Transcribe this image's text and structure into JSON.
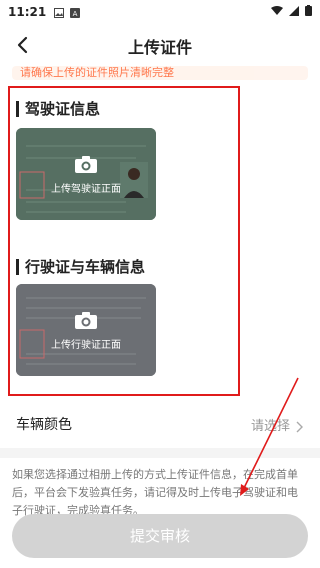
{
  "status": {
    "time": "11:21"
  },
  "nav": {
    "title": "上传证件"
  },
  "notice": {
    "text": "请确保上传的证件照片清晰完整"
  },
  "sections": [
    {
      "title": "驾驶证信息",
      "card_label": "上传驾驶证正面"
    },
    {
      "title": "行驶证与车辆信息",
      "card_label": "上传行驶证正面"
    }
  ],
  "vehicle_color": {
    "label": "车辆颜色",
    "value": "请选择"
  },
  "help_text": "如果您选择通过相册上传的方式上传证件信息，在完成首单后，平台会下发验真任务，请记得及时上传电子驾驶证和电子行驶证，完成验真任务。",
  "submit": {
    "label": "提交审核"
  },
  "colors": {
    "highlight": "#e01b1b",
    "accent": "#ff6a3a"
  }
}
